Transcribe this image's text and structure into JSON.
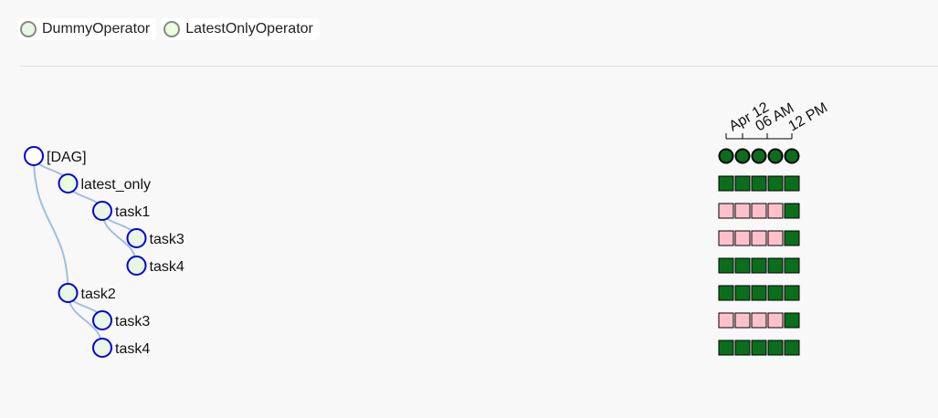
{
  "legend": [
    {
      "label": "DummyOperator",
      "color": "#e8f7e4"
    },
    {
      "label": "LatestOnlyOperator",
      "color": "#e9ffdb"
    }
  ],
  "colors": {
    "node_stroke": "#0000dd",
    "edge": "#9fbfdc",
    "success": "#0b6e1c",
    "skipped": "#ffc0cb",
    "dag_run_fill": "#0b6e1c"
  },
  "runs": {
    "labels": [
      "Apr 12",
      "06 AM",
      "12 PM"
    ],
    "count": 5,
    "dag_run_states": [
      "success",
      "success",
      "success",
      "success",
      "success"
    ]
  },
  "tree": [
    {
      "label": "[DAG]",
      "depth": 0,
      "parent": null,
      "node_fill": "#ffffff",
      "states": []
    },
    {
      "label": "latest_only",
      "depth": 1,
      "parent": 0,
      "node_fill": "#e9ffdb",
      "states": [
        "success",
        "success",
        "success",
        "success",
        "success"
      ]
    },
    {
      "label": "task1",
      "depth": 2,
      "parent": 1,
      "node_fill": "#e8f7e4",
      "states": [
        "skipped",
        "skipped",
        "skipped",
        "skipped",
        "success"
      ]
    },
    {
      "label": "task3",
      "depth": 3,
      "parent": 2,
      "node_fill": "#e8f7e4",
      "states": [
        "skipped",
        "skipped",
        "skipped",
        "skipped",
        "success"
      ]
    },
    {
      "label": "task4",
      "depth": 3,
      "parent": 2,
      "node_fill": "#e8f7e4",
      "states": [
        "success",
        "success",
        "success",
        "success",
        "success"
      ]
    },
    {
      "label": "task2",
      "depth": 1,
      "parent": 0,
      "node_fill": "#e8f7e4",
      "states": [
        "success",
        "success",
        "success",
        "success",
        "success"
      ]
    },
    {
      "label": "task3",
      "depth": 2,
      "parent": 5,
      "node_fill": "#e8f7e4",
      "states": [
        "skipped",
        "skipped",
        "skipped",
        "skipped",
        "success"
      ]
    },
    {
      "label": "task4",
      "depth": 2,
      "parent": 5,
      "node_fill": "#e8f7e4",
      "states": [
        "success",
        "success",
        "success",
        "success",
        "success"
      ]
    }
  ]
}
